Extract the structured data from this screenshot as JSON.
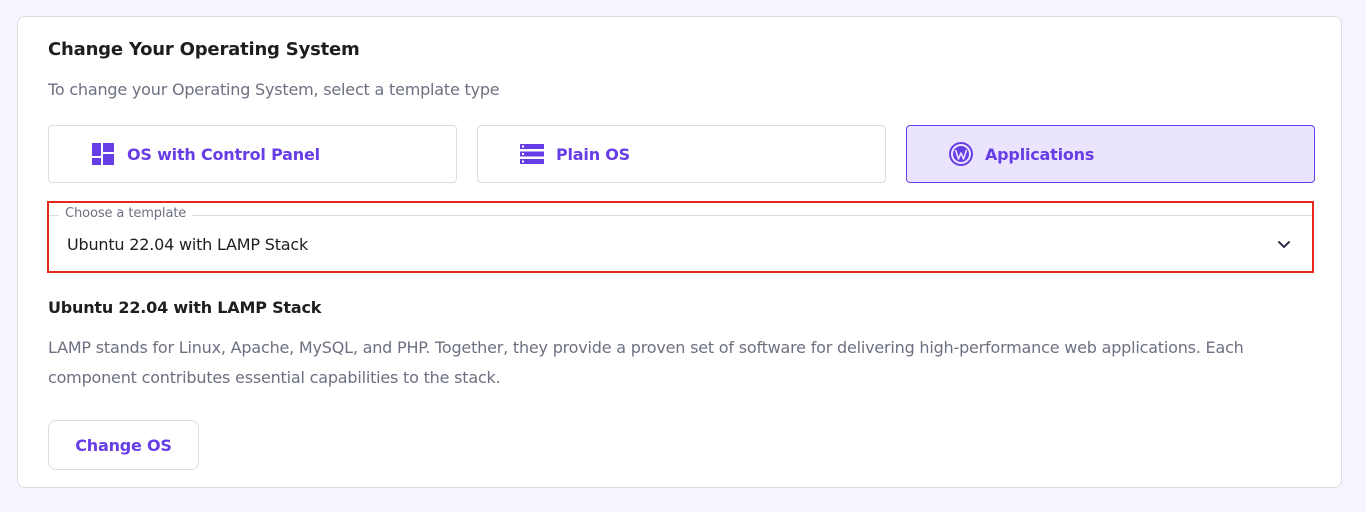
{
  "page": {
    "title": "Change Your Operating System",
    "subtitle": "To change your Operating System, select a template type"
  },
  "template_types": [
    {
      "label": "OS with Control Panel",
      "icon": "dashboard-grid-icon",
      "selected": false
    },
    {
      "label": "Plain OS",
      "icon": "server-list-icon",
      "selected": false
    },
    {
      "label": "Applications",
      "icon": "wordpress-icon",
      "selected": true
    }
  ],
  "template_select": {
    "legend": "Choose a template",
    "value": "Ubuntu 22.04 with LAMP Stack",
    "icon": "chevron-down-icon"
  },
  "details": {
    "title": "Ubuntu 22.04 with LAMP Stack",
    "description": "LAMP stands for Linux, Apache, MySQL, and PHP. Together, they provide a proven set of software for delivering high-performance web applications. Each component contributes essential capabilities to the stack."
  },
  "actions": {
    "change_os_label": "Change OS"
  },
  "colors": {
    "accent": "#673de6",
    "selected_bg": "#ebe4ff",
    "highlight": "#e8281c",
    "page_bg": "#f4f5ff"
  }
}
